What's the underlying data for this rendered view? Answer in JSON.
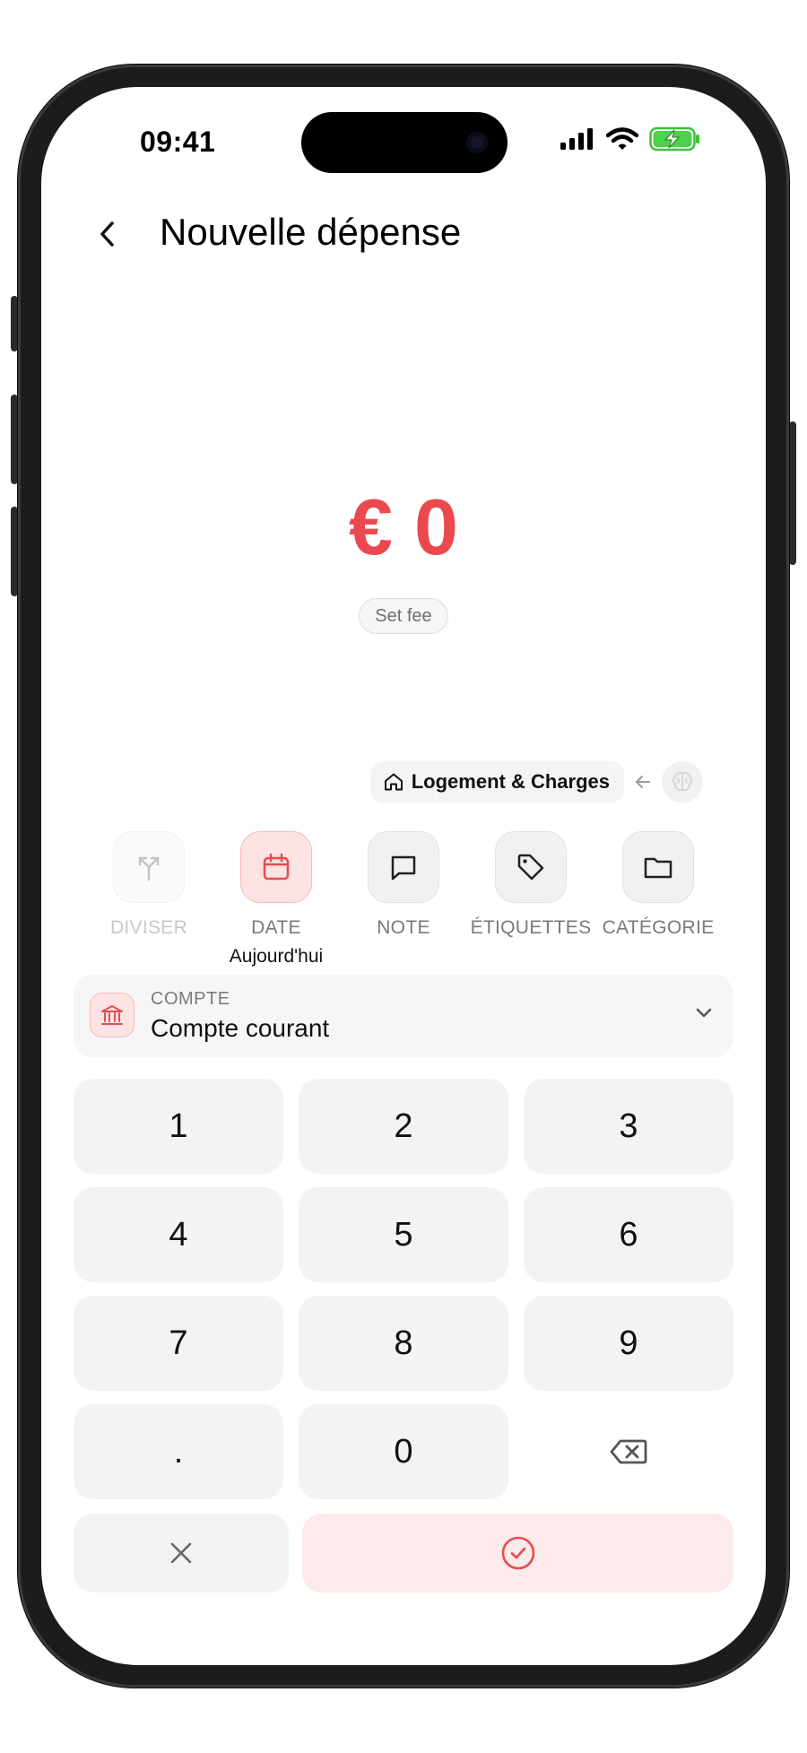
{
  "status_bar": {
    "time": "09:41"
  },
  "header": {
    "title": "Nouvelle dépense"
  },
  "amount": {
    "currency": "€",
    "value": "0"
  },
  "set_fee": {
    "label": "Set fee"
  },
  "suggestion": {
    "category_label": "Logement & Charges"
  },
  "actions": [
    {
      "label": "DIVISER",
      "sublabel": "",
      "state": "disabled"
    },
    {
      "label": "DATE",
      "sublabel": "Aujourd'hui",
      "state": "active"
    },
    {
      "label": "NOTE",
      "sublabel": "",
      "state": "normal"
    },
    {
      "label": "ÉTIQUETTES",
      "sublabel": "",
      "state": "normal"
    },
    {
      "label": "CATÉGORIE",
      "sublabel": "",
      "state": "normal"
    }
  ],
  "account": {
    "label": "COMPTE",
    "value": "Compte courant"
  },
  "keypad": {
    "keys": [
      "1",
      "2",
      "3",
      "4",
      "5",
      "6",
      "7",
      "8",
      "9",
      ".",
      "0"
    ]
  },
  "colors": {
    "accent": "#ea4a4f",
    "accent_soft": "#fde3e4",
    "key_bg": "#f3f3f3",
    "muted_text": "#7a7a7a"
  },
  "icons": {
    "back": "chevron-left-icon",
    "diviser": "split-arrows-icon",
    "date": "calendar-icon",
    "note": "speech-bubble-icon",
    "etiquettes": "tag-icon",
    "categorie": "folder-icon",
    "account": "bank-icon",
    "dropdown": "chevron-down-icon",
    "backspace": "backspace-icon",
    "cancel": "close-icon",
    "confirm": "check-circle-icon"
  }
}
